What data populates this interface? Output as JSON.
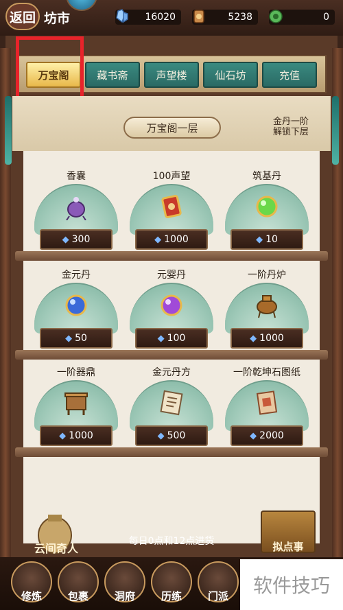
{
  "header": {
    "back_label": "返回",
    "title": "坊市",
    "currencies": [
      {
        "icon": "spirit-stone-icon",
        "value": "16020"
      },
      {
        "icon": "merit-icon",
        "value": "5238"
      },
      {
        "icon": "jade-coin-icon",
        "value": "0"
      }
    ]
  },
  "tabs": [
    {
      "label": "万宝阁",
      "active": true
    },
    {
      "label": "藏书斋",
      "active": false
    },
    {
      "label": "声望楼",
      "active": false
    },
    {
      "label": "仙石坊",
      "active": false
    },
    {
      "label": "充值",
      "active": false
    }
  ],
  "floor": {
    "label": "万宝阁一层",
    "unlock_hint_line1": "金丹一阶",
    "unlock_hint_line2": "解锁下层"
  },
  "items": [
    {
      "name": "香囊",
      "price": "300",
      "icon": "sachet-icon"
    },
    {
      "name": "100声望",
      "price": "1000",
      "icon": "reputation-token-icon"
    },
    {
      "name": "筑基丹",
      "price": "10",
      "icon": "green-pill-icon"
    },
    {
      "name": "金元丹",
      "price": "50",
      "icon": "blue-pill-icon"
    },
    {
      "name": "元婴丹",
      "price": "100",
      "icon": "purple-pill-icon"
    },
    {
      "name": "一阶丹炉",
      "price": "1000",
      "icon": "cauldron-icon"
    },
    {
      "name": "一阶器鼎",
      "price": "1000",
      "icon": "forge-icon"
    },
    {
      "name": "金元丹方",
      "price": "500",
      "icon": "recipe-scroll-icon"
    },
    {
      "name": "一阶乾坤石图纸",
      "price": "2000",
      "icon": "blueprint-icon"
    }
  ],
  "restock_text": "每日0点和12点进货",
  "bottom_left_label": "云间奇人",
  "bottom_right_label": "拟点事",
  "nav": [
    {
      "label": "修炼",
      "icon": "cultivator-icon"
    },
    {
      "label": "包裹",
      "icon": "bag-icon"
    },
    {
      "label": "洞府",
      "icon": "cave-icon"
    },
    {
      "label": "历练",
      "icon": "scroll-icon"
    },
    {
      "label": "门派",
      "icon": "sect-icon"
    }
  ],
  "watermark": "软件技巧",
  "colors": {
    "highlight": "#e8232a",
    "tab_active": "#e8b84a",
    "tab_inactive": "#2a6a64"
  }
}
